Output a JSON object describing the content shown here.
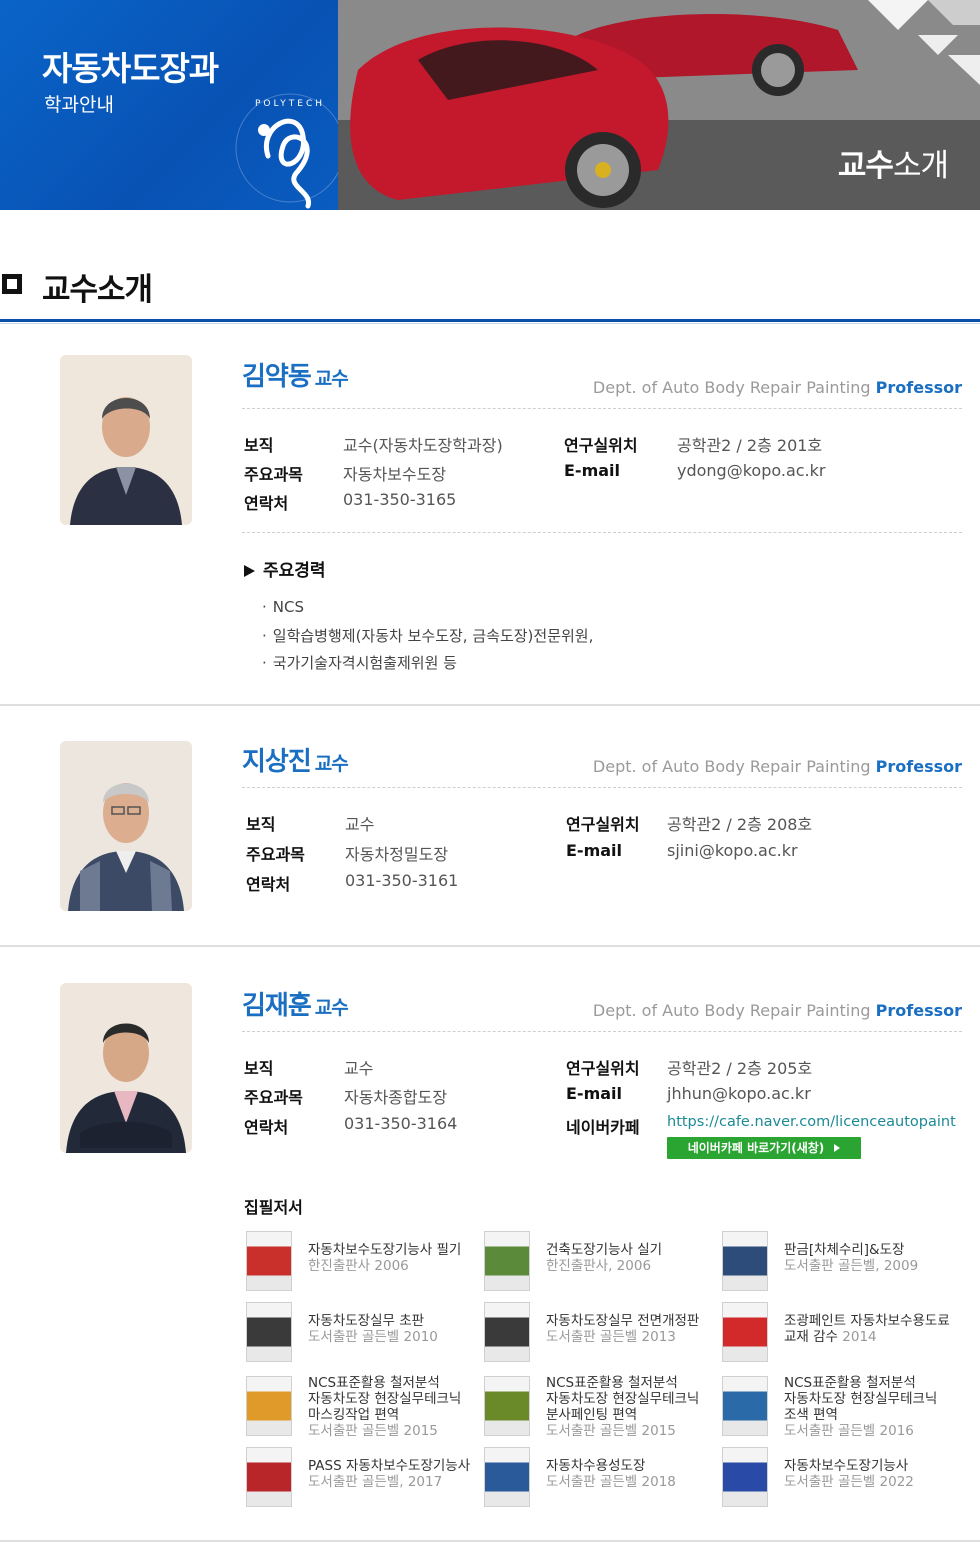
{
  "banner": {
    "department": "자동차도장과",
    "subtitle": "학과안내",
    "logo_text": "KOREA POLYTECHNICS",
    "right_title_bold": "교수",
    "right_title_normal": "소개"
  },
  "section": {
    "title": "교수소개"
  },
  "professors": [
    {
      "name": "김약동",
      "rank": "교수",
      "dept": "Dept. of Auto Body Repair Painting",
      "role": "Professor",
      "fields": {
        "position_label": "보직",
        "position": "교수(자동차도장학과장)",
        "subject_label": "주요과목",
        "subject": "자동차보수도장",
        "contact_label": "연락처",
        "contact": "031-350-3165",
        "lab_label": "연구실위치",
        "lab": "공학관2 / 2층 201호",
        "email_label": "E-mail",
        "email": "ydong@kopo.ac.kr"
      },
      "career_title": "주요경력",
      "career": [
        "NCS",
        "일학습병행제(자동차 보수도장, 금속도장)전문위원,",
        "국가기술자격시험출제위원 등"
      ]
    },
    {
      "name": "지상진",
      "rank": "교수",
      "dept": "Dept. of Auto Body Repair Painting",
      "role": "Professor",
      "fields": {
        "position_label": "보직",
        "position": "교수",
        "subject_label": "주요과목",
        "subject": "자동차정밀도장",
        "contact_label": "연락처",
        "contact": "031-350-3161",
        "lab_label": "연구실위치",
        "lab": "공학관2 / 2층 208호",
        "email_label": "E-mail",
        "email": "sjini@kopo.ac.kr"
      }
    },
    {
      "name": "김재훈",
      "rank": "교수",
      "dept": "Dept. of Auto Body Repair Painting",
      "role": "Professor",
      "fields": {
        "position_label": "보직",
        "position": "교수",
        "subject_label": "주요과목",
        "subject": "자동차종합도장",
        "contact_label": "연락처",
        "contact": "031-350-3164",
        "lab_label": "연구실위치",
        "lab": "공학관2 / 2층 205호",
        "email_label": "E-mail",
        "email": "jhhun@kopo.ac.kr",
        "cafe_label": "네이버카페",
        "cafe": "https://cafe.naver.com/licenceautopaint"
      },
      "cafe_button": "네이버카페 바로가기(새창)",
      "books_title": "집필저서",
      "books": [
        {
          "title": "자동차보수도장기능사 필기",
          "publisher": "한진출판사 2006",
          "cover_color": "#c9302c"
        },
        {
          "title": "건축도장기능사 실기",
          "publisher": "한진출판사, 2006",
          "cover_color": "#5a8a3a"
        },
        {
          "title": "판금[차체수리]&도장",
          "publisher": "도서출판 골든벨, 2009",
          "cover_color": "#2e4c7a"
        },
        {
          "title": "자동차도장실무 초판",
          "publisher": "도서출판 골든벨 2010",
          "cover_color": "#3a3a3a"
        },
        {
          "title": "자동차도장실무 전면개정판",
          "publisher": "도서출판 골든벨 2013",
          "cover_color": "#3a3a3a"
        },
        {
          "title": "조광페인트 자동차보수용도료",
          "title2": "교재 감수",
          "title2_suffix": " 2014",
          "publisher": "",
          "cover_color": "#d22a2a"
        },
        {
          "title": "NCS표준활용 철저분석",
          "title2": "자동차도장 현장실무테크닉",
          "title3": "마스킹작업 편역",
          "publisher": "도서출판 골든벨 2015",
          "cover_color": "#e09a2a"
        },
        {
          "title": "NCS표준활용 철저분석",
          "title2": "자동차도장 현장실무테크닉",
          "title3": "분사페인팅 편역",
          "publisher": "도서출판 골든벨 2015",
          "cover_color": "#6a8a2a"
        },
        {
          "title": "NCS표준활용 철저분석",
          "title2": "자동차도장 현장실무테크닉",
          "title3": "조색 편역",
          "publisher": "도서출판 골든벨 2016",
          "cover_color": "#2a6aa8"
        },
        {
          "title": "PASS 자동차보수도장기능사",
          "publisher": "도서출판 골든벨, 2017",
          "cover_color": "#b8262a"
        },
        {
          "title": "자동차수용성도장",
          "publisher": "도서출판 골든벨 2018",
          "cover_color": "#2a5a9a"
        },
        {
          "title": "자동차보수도장기능사",
          "publisher": "도서출판 골든벨 2022",
          "cover_color": "#2a4aa8"
        }
      ]
    }
  ]
}
